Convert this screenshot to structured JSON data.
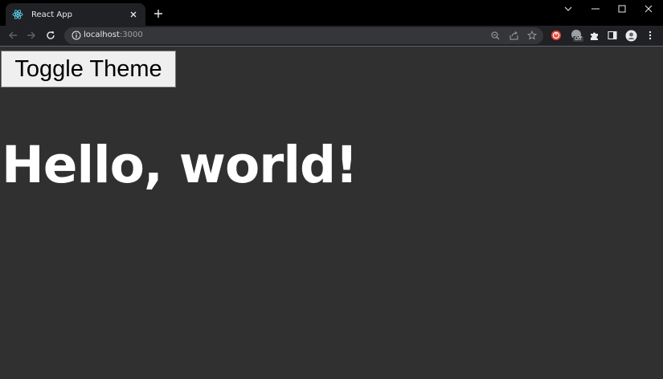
{
  "browser": {
    "tab": {
      "title": "React App",
      "favicon": "react-logo-icon"
    },
    "address": {
      "host": "localhost",
      "port": ":3000"
    },
    "extension_badge": "Off",
    "colors": {
      "titlebar": "#000000",
      "toolbar": "#202124",
      "omnibox": "#35363a",
      "react_accent": "#61dafb"
    }
  },
  "page": {
    "toggle_button_label": "Toggle Theme",
    "heading": "Hello, world!",
    "colors": {
      "background": "#303030",
      "heading": "#ffffff",
      "button_bg": "#efefef"
    }
  }
}
